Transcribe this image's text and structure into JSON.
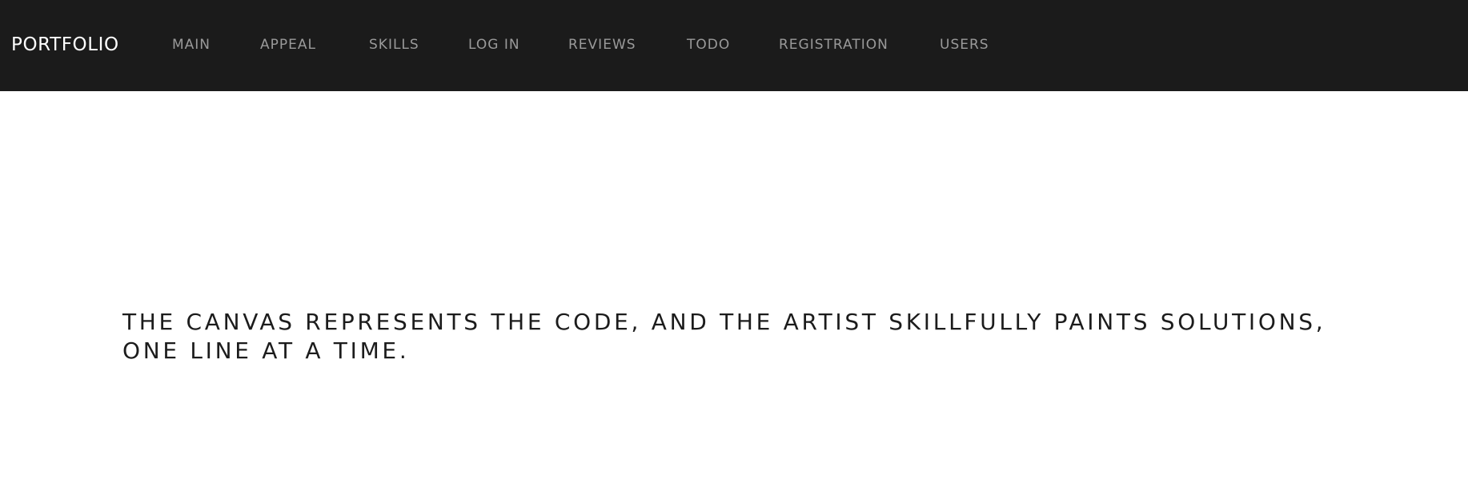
{
  "navbar": {
    "brand": "PORTFOLIO",
    "items": [
      {
        "label": "MAIN"
      },
      {
        "label": "APPEAL"
      },
      {
        "label": "SKILLS"
      },
      {
        "label": "LOG IN"
      },
      {
        "label": "REVIEWS"
      },
      {
        "label": "TODO"
      },
      {
        "label": "REGISTRATION"
      },
      {
        "label": "USERS"
      }
    ]
  },
  "hero": {
    "line1": "THE CANVAS REPRESENTS THE CODE, AND THE ARTIST SKILLFULLY PAINTS SOLUTIONS,",
    "line2": "ONE LINE AT A TIME."
  },
  "colors": {
    "navbar_bg": "#1b1b1b",
    "brand": "#ffffff",
    "nav_item": "#9a9a9a",
    "hero_text": "#1c1c1c",
    "page_bg": "#ffffff"
  }
}
